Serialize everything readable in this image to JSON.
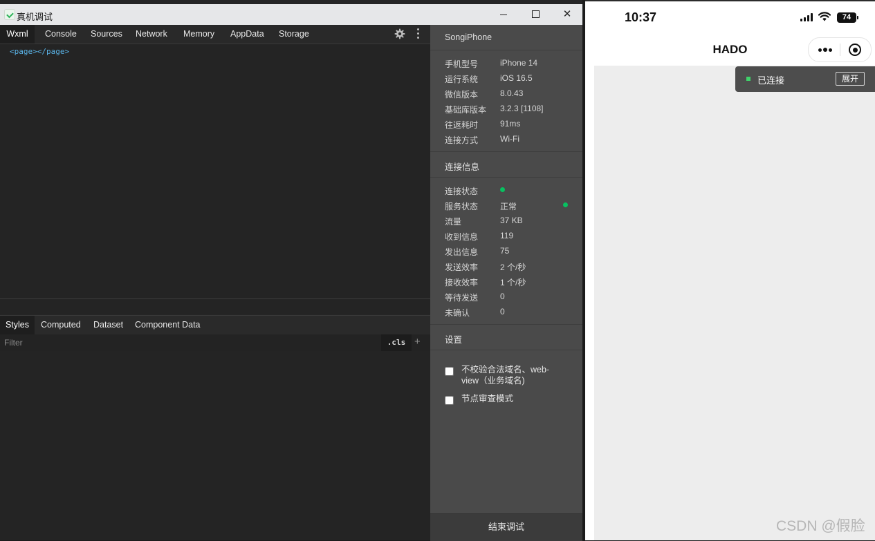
{
  "window": {
    "title": "真机调试",
    "minimize_label": "",
    "maximize_label": "",
    "close_label": "✕"
  },
  "top_tabs": [
    "Wxml",
    "Console",
    "Sources",
    "Network",
    "Memory",
    "AppData",
    "Storage"
  ],
  "wxml": {
    "code": "<page></page>"
  },
  "bottom_tabs": [
    "Styles",
    "Computed",
    "Dataset",
    "Component Data"
  ],
  "filter": {
    "placeholder": "Filter",
    "cls_label": ".cls",
    "add_label": "+"
  },
  "device": {
    "name": "SongiPhone",
    "info": [
      {
        "label": "手机型号",
        "value": "iPhone 14"
      },
      {
        "label": "运行系统",
        "value": "iOS 16.5"
      },
      {
        "label": "微信版本",
        "value": "8.0.43"
      },
      {
        "label": "基础库版本",
        "value": "3.2.3 [1108]"
      },
      {
        "label": "往返耗时",
        "value": "91ms"
      },
      {
        "label": "连接方式",
        "value": "Wi-Fi"
      }
    ],
    "connection_header": "连接信息",
    "connection": [
      {
        "label": "连接状态",
        "value": ""
      },
      {
        "label": "服务状态",
        "value": "正常"
      },
      {
        "label": "流量",
        "value": "37 KB"
      },
      {
        "label": "收到信息",
        "value": "119"
      },
      {
        "label": "发出信息",
        "value": "75"
      },
      {
        "label": "发送效率",
        "value": "2 个/秒"
      },
      {
        "label": "接收效率",
        "value": "1 个/秒"
      },
      {
        "label": "等待发送",
        "value": "0"
      },
      {
        "label": "未确认",
        "value": "0"
      }
    ],
    "settings_header": "设置",
    "settings": [
      {
        "label": "不校验合法域名、web-view（业务域名)",
        "checked": false
      },
      {
        "label": "节点审查模式",
        "checked": false
      }
    ],
    "end_button": "结束调试",
    "status_color": "#07c160"
  },
  "phone": {
    "time": "10:37",
    "battery": "74",
    "nav_title": "HADO",
    "banner_text": "已连接",
    "banner_button": "展开"
  },
  "watermark": "CSDN @假脸"
}
